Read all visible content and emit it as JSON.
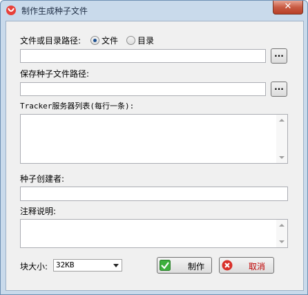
{
  "window": {
    "title": "制作生成种子文件",
    "close_symbol": "✕"
  },
  "source": {
    "label": "文件或目录路径:",
    "option_file": "文件",
    "option_dir": "目录",
    "selected": "file",
    "path_value": "",
    "browse_label": "..."
  },
  "save": {
    "label": "保存种子文件路径:",
    "path_value": "",
    "browse_label": "..."
  },
  "tracker": {
    "label": "Tracker服务器列表(每行一条):",
    "value": ""
  },
  "creator": {
    "label": "种子创建者:",
    "value": ""
  },
  "comment": {
    "label": "注释说明:",
    "value": ""
  },
  "block": {
    "label": "块大小:",
    "selected": "32KB"
  },
  "buttons": {
    "make": "制作",
    "cancel": "取消"
  }
}
